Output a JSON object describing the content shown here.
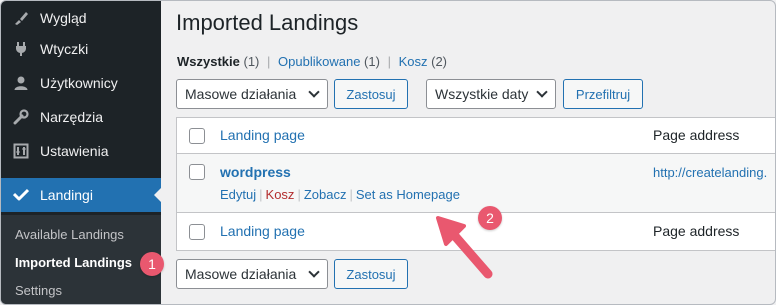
{
  "sidebar": {
    "items": [
      {
        "label": "Wygląd",
        "icon": "paintbrush-icon"
      },
      {
        "label": "Wtyczki",
        "icon": "plug-icon"
      },
      {
        "label": "Użytkownicy",
        "icon": "user-icon"
      },
      {
        "label": "Narzędzia",
        "icon": "wrench-icon"
      },
      {
        "label": "Ustawienia",
        "icon": "settings-icon"
      },
      {
        "label": "Landingi",
        "icon": "landingi-icon"
      }
    ],
    "submenu": [
      {
        "label": "Available Landings"
      },
      {
        "label": "Imported Landings"
      },
      {
        "label": "Settings"
      }
    ]
  },
  "page": {
    "title": "Imported Landings",
    "views": {
      "all_label": "Wszystkie",
      "all_count": "(1)",
      "published_label": "Opublikowane",
      "published_count": "(1)",
      "trash_label": "Kosz",
      "trash_count": "(2)",
      "sep": "|"
    }
  },
  "toolbar_top": {
    "bulk_select": "Masowe działania",
    "apply_button": "Zastosuj",
    "date_select": "Wszystkie daty",
    "filter_button": "Przefiltruj"
  },
  "table": {
    "headers": {
      "title": "Landing page",
      "address": "Page address"
    },
    "rows": [
      {
        "title": "wordpress",
        "address": "http://createlanding.",
        "actions": {
          "edit": "Edytuj",
          "trash": "Kosz",
          "view": "Zobacz",
          "homepage": "Set as Homepage"
        }
      }
    ],
    "footer": {
      "title": "Landing page",
      "address": "Page address"
    }
  },
  "toolbar_bottom": {
    "bulk_select": "Masowe działania",
    "apply_button": "Zastosuj"
  },
  "annotations": {
    "badge1": "1",
    "badge2": "2",
    "color": "#e9586f"
  },
  "colors": {
    "sidebar_bg": "#1d2327",
    "accent": "#2271b1",
    "danger": "#b32d2e"
  }
}
